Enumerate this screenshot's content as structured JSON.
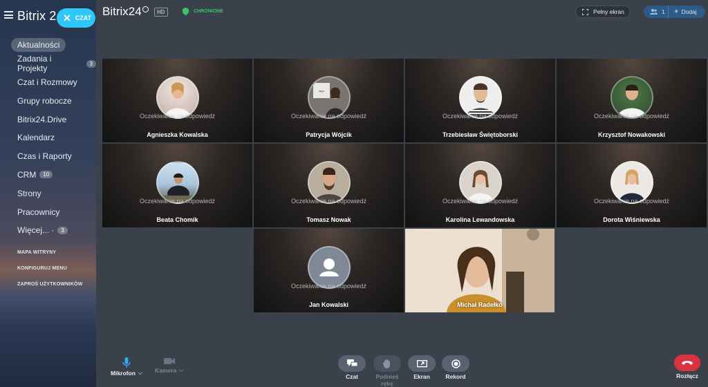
{
  "sidebar": {
    "brand": "Bitrix 2",
    "chat_button": "CZAT",
    "items": [
      {
        "label": "Aktualności",
        "count": ""
      },
      {
        "label": "Zadania i Projekty",
        "count": "3"
      },
      {
        "label": "Czat i Rozmowy",
        "count": ""
      },
      {
        "label": "Grupy robocze",
        "count": ""
      },
      {
        "label": "Bitrix24.Drive",
        "count": ""
      },
      {
        "label": "Kalendarz",
        "count": ""
      },
      {
        "label": "Czas i Raporty",
        "count": ""
      },
      {
        "label": "CRM",
        "count": "10"
      },
      {
        "label": "Strony",
        "count": ""
      },
      {
        "label": "Pracownicy",
        "count": ""
      },
      {
        "label": "Więcej... ·",
        "count": "3"
      }
    ],
    "links": [
      "MAPA WITRYNY",
      "KONFIGURUJ MENU",
      "ZAPROŚ UŻYTKOWNIKÓW"
    ]
  },
  "header": {
    "brand": "Bitrix24",
    "hd": "HD",
    "secure": "CHRONIONE",
    "fullscreen": "Pełny ekran",
    "users_count": "1",
    "add": "Dodaj"
  },
  "waiting_text": "Oczekiwanie na odpowiedź",
  "participants": [
    {
      "name": "Agnieszka Kowalska"
    },
    {
      "name": "Patrycja Wójcik"
    },
    {
      "name": "Trzebiesław Świętoborski"
    },
    {
      "name": "Krzysztof Nowakowski"
    },
    {
      "name": "Beata Chomik"
    },
    {
      "name": "Tomasz Nowak"
    },
    {
      "name": "Karolina Lewandowska"
    },
    {
      "name": "Dorota Wiśniewska"
    },
    {
      "name": "Jan Kowalski"
    }
  ],
  "video": {
    "name": "Michał Radełko"
  },
  "controls": {
    "mic": "Mikrofon",
    "camera": "Kamera",
    "chat": "Czat",
    "raise_hand_1": "Podnieś",
    "raise_hand_2": "rękę",
    "screen": "Ekran",
    "record": "Rekord",
    "hangup": "Rozłącz"
  },
  "colors": {
    "accent": "#2fc7f7",
    "secure": "#3dc26a",
    "hangup": "#d9333f",
    "background": "#3a414b"
  }
}
